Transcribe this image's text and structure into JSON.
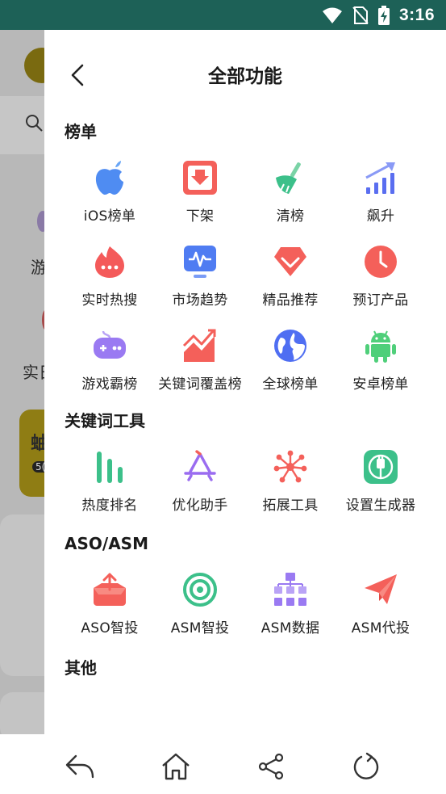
{
  "status_bar": {
    "time": "3:16",
    "icons": [
      "wifi-icon",
      "no-sim-icon",
      "battery-charging-icon"
    ],
    "background": "#1d6157"
  },
  "background_page": {
    "partial_texts": [
      "游",
      "实日",
      "蚰",
      "5("
    ]
  },
  "drawer": {
    "title": "全部功能",
    "back_icon": "chevron-left-icon",
    "sections": [
      {
        "title": "榜单",
        "items": [
          {
            "label": "iOS榜单",
            "icon": "apple-icon"
          },
          {
            "label": "下架",
            "icon": "download-box-icon"
          },
          {
            "label": "清榜",
            "icon": "broom-icon"
          },
          {
            "label": "飙升",
            "icon": "trending-up-icon"
          },
          {
            "label": "实时热搜",
            "icon": "fire-chat-icon"
          },
          {
            "label": "市场趋势",
            "icon": "pulse-monitor-icon"
          },
          {
            "label": "精品推荐",
            "icon": "diamond-icon"
          },
          {
            "label": "预订产品",
            "icon": "clock-icon"
          },
          {
            "label": "游戏霸榜",
            "icon": "gamepad-icon"
          },
          {
            "label": "关键词覆盖榜",
            "icon": "area-chart-icon"
          },
          {
            "label": "全球榜单",
            "icon": "globe-icon"
          },
          {
            "label": "安卓榜单",
            "icon": "android-icon"
          }
        ]
      },
      {
        "title": "关键词工具",
        "items": [
          {
            "label": "热度排名",
            "icon": "bars-icon"
          },
          {
            "label": "优化助手",
            "icon": "app-store-icon"
          },
          {
            "label": "拓展工具",
            "icon": "network-icon"
          },
          {
            "label": "设置生成器",
            "icon": "plug-icon"
          }
        ]
      },
      {
        "title": "ASO/ASM",
        "items": [
          {
            "label": "ASO智投",
            "icon": "upload-box-icon"
          },
          {
            "label": "ASM智投",
            "icon": "target-icon"
          },
          {
            "label": "ASM数据",
            "icon": "hierarchy-icon"
          },
          {
            "label": "ASM代投",
            "icon": "paper-plane-icon"
          }
        ]
      },
      {
        "title": "其他",
        "items": []
      }
    ]
  },
  "nav_bar": {
    "buttons": [
      "back-arrow-icon",
      "home-icon",
      "share-icon",
      "refresh-icon"
    ]
  },
  "colors": {
    "apple": "#4f8cf2",
    "download": "#f4605a",
    "broom": "#3cc08a",
    "trend": "#5a6ef0",
    "fire": "#f45a5a",
    "monitor": "#4f7cf2",
    "diamond": "#f4605a",
    "clock": "#f4605a",
    "gamepad": "#9a7af2",
    "area": "#f4605a",
    "globe": "#4f6ef2",
    "android": "#4fcf7a",
    "bars": "#3cc08a",
    "appstore": "#9a6cf0",
    "network": "#f4605a",
    "plug": "#3cc08a",
    "upload": "#f4605a",
    "target": "#3cc08a",
    "hierarchy": "#9a7af2",
    "plane": "#f4605a"
  }
}
